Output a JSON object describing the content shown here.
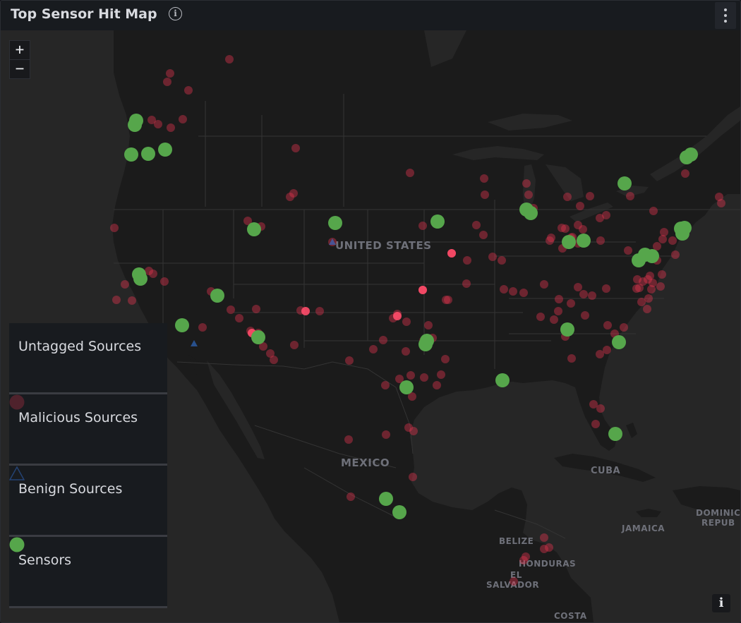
{
  "header": {
    "title": "Top Sensor Hit Map",
    "info_icon": "info-circle-icon",
    "menu_icon": "kebab-menu-icon"
  },
  "zoom": {
    "in_label": "+",
    "out_label": "−"
  },
  "legend": {
    "items": [
      {
        "label": "Untagged Sources",
        "symbol": "none"
      },
      {
        "label": "Malicious Sources",
        "symbol": "circle",
        "color": "#e0354f"
      },
      {
        "label": "Benign Sources",
        "symbol": "triangle",
        "color": "#3274d9"
      },
      {
        "label": "Sensors",
        "symbol": "circle",
        "color": "#56a64b"
      }
    ]
  },
  "map_labels": [
    {
      "text": "UNITED STATES"
    },
    {
      "text": "MEXICO"
    },
    {
      "text": "CUBA"
    },
    {
      "text": "JAMAICA"
    },
    {
      "text": "DOMINIC"
    },
    {
      "text": "REPUB"
    },
    {
      "text": "BELIZE"
    },
    {
      "text": "HONDURAS"
    },
    {
      "text": "EL"
    },
    {
      "text": "SALVADOR"
    },
    {
      "text": "COSTA"
    }
  ],
  "attribution": {
    "label": "i"
  },
  "colors": {
    "malicious": "#e0354f",
    "sensor": "#56a64b",
    "benign": "#3274d9",
    "land": "#1b1b1b",
    "water": "#262626"
  }
}
